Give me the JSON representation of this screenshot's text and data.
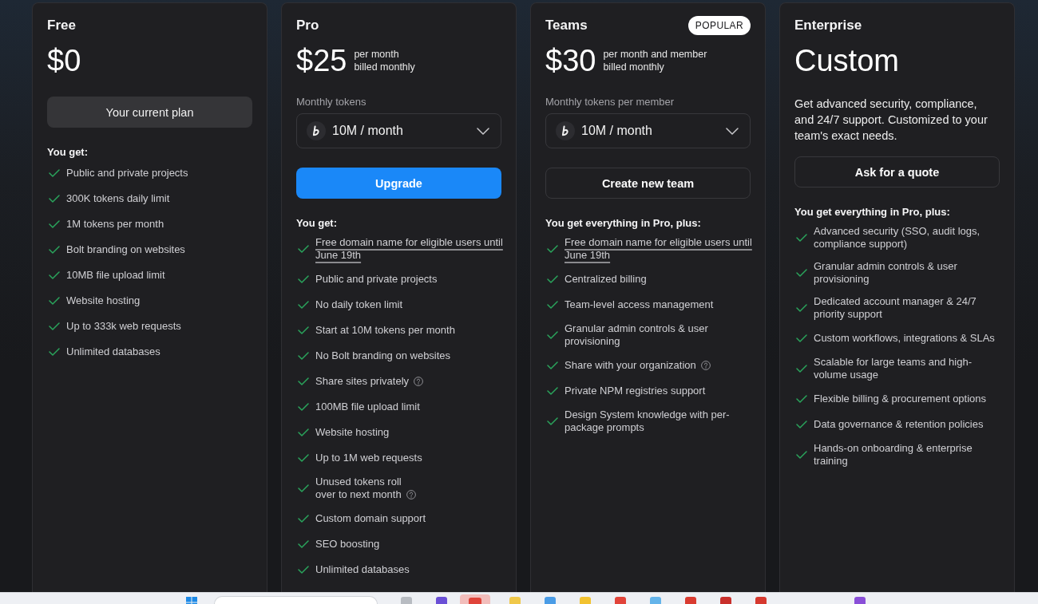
{
  "plans": [
    {
      "name": "Free",
      "price": "$0",
      "button": {
        "label": "Your current plan",
        "kind": "current"
      },
      "features_title": "You get:",
      "features": [
        {
          "text": "Public and private projects",
          "kind": "text",
          "info": false
        },
        {
          "text": "300K tokens daily limit",
          "kind": "text",
          "info": false
        },
        {
          "text": "1M tokens per month",
          "kind": "text",
          "info": false
        },
        {
          "text": "Bolt branding on websites",
          "kind": "text",
          "info": false
        },
        {
          "text": "10MB file upload limit",
          "kind": "text",
          "info": false
        },
        {
          "text": "Website hosting",
          "kind": "text",
          "info": false
        },
        {
          "text": "Up to 333k web requests",
          "kind": "text",
          "info": false
        },
        {
          "text": "Unlimited databases",
          "kind": "text",
          "info": false
        }
      ]
    },
    {
      "name": "Pro",
      "price": "$25",
      "price_note": [
        "per month",
        "billed monthly"
      ],
      "tokens": {
        "label": "Monthly tokens",
        "value": "10M / month"
      },
      "button": {
        "label": "Upgrade",
        "kind": "primary"
      },
      "features_title": "You get:",
      "features": [
        {
          "text": "Free domain name for eligible users until June 19th",
          "kind": "link",
          "info": false
        },
        {
          "text": "Public and private projects",
          "kind": "text",
          "info": false
        },
        {
          "text": "No daily token limit",
          "kind": "text",
          "info": false
        },
        {
          "text": "Start at 10M tokens per month",
          "kind": "text",
          "info": false
        },
        {
          "text": "No Bolt branding on websites",
          "kind": "text",
          "info": false
        },
        {
          "text": "Share sites privately",
          "kind": "text",
          "info": true
        },
        {
          "text": "100MB file upload limit",
          "kind": "text",
          "info": false
        },
        {
          "text": "Website hosting",
          "kind": "text",
          "info": false
        },
        {
          "text": "Up to 1M web requests",
          "kind": "text",
          "info": false
        },
        {
          "text": "Unused tokens roll\nover to next month",
          "kind": "text",
          "info": true
        },
        {
          "text": "Custom domain support",
          "kind": "text",
          "info": false
        },
        {
          "text": "SEO boosting",
          "kind": "text",
          "info": false
        },
        {
          "text": "Unlimited databases",
          "kind": "text",
          "info": false
        }
      ]
    },
    {
      "name": "Teams",
      "badge": "POPULAR",
      "price": "$30",
      "price_note": [
        "per month and member",
        "billed monthly"
      ],
      "tokens": {
        "label": "Monthly tokens per member",
        "value": "10M / month"
      },
      "button": {
        "label": "Create new team",
        "kind": "outline"
      },
      "features_title": "You get everything in Pro, plus:",
      "features": [
        {
          "text": "Free domain name for eligible users until June 19th",
          "kind": "link",
          "info": false
        },
        {
          "text": "Centralized billing",
          "kind": "text",
          "info": false
        },
        {
          "text": "Team-level access management",
          "kind": "text",
          "info": false
        },
        {
          "text": "Granular admin controls & user provisioning",
          "kind": "text",
          "info": false
        },
        {
          "text": "Share with your organization",
          "kind": "text",
          "info": true
        },
        {
          "text": "Private NPM registries support",
          "kind": "text",
          "info": false
        },
        {
          "text": "Design System knowledge with per-package prompts",
          "kind": "text",
          "info": false
        }
      ]
    },
    {
      "name": "Enterprise",
      "price": "Custom",
      "description": "Get advanced security, compliance, and 24/7 support. Customized to your team's exact needs.",
      "button": {
        "label": "Ask for a quote",
        "kind": "outline"
      },
      "features_title": "You get everything in Pro, plus:",
      "features": [
        {
          "text": "Advanced security (SSO, audit logs, compliance support)",
          "kind": "text",
          "info": false
        },
        {
          "text": "Granular admin controls & user provisioning",
          "kind": "text",
          "info": false
        },
        {
          "text": "Dedicated account manager & 24/7 priority support",
          "kind": "text",
          "info": false
        },
        {
          "text": "Custom workflows, integrations & SLAs",
          "kind": "text",
          "info": false
        },
        {
          "text": "Scalable for large teams and high-volume usage",
          "kind": "text",
          "info": false
        },
        {
          "text": "Flexible billing & procurement options",
          "kind": "text",
          "info": false
        },
        {
          "text": "Data governance & retention policies",
          "kind": "text",
          "info": false
        },
        {
          "text": "Hands-on onboarding & enterprise training",
          "kind": "text",
          "info": false
        }
      ]
    }
  ]
}
